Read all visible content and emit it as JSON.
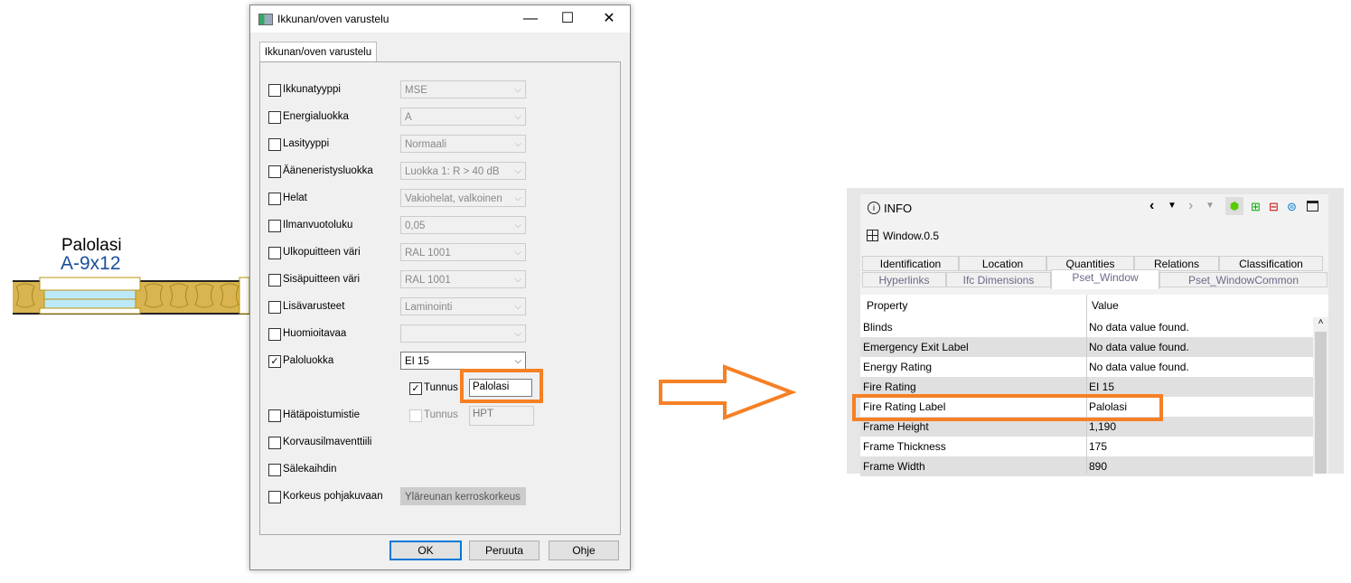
{
  "drawing": {
    "label1": "Palolasi",
    "label2": "A-9x12"
  },
  "dialog": {
    "title": "Ikkunan/oven varustelu",
    "tab": "Ikkunan/oven varustelu",
    "rows": [
      {
        "label": "Ikkunatyyppi",
        "value": "MSE",
        "checked": false
      },
      {
        "label": "Energialuokka",
        "value": "A",
        "checked": false
      },
      {
        "label": "Lasityyppi",
        "value": "Normaali",
        "checked": false
      },
      {
        "label": "Ääneneristysluokka",
        "value": "Luokka 1: R > 40 dB",
        "checked": false
      },
      {
        "label": "Helat",
        "value": "Vakiohelat, valkoinen",
        "checked": false
      },
      {
        "label": "Ilmanvuotoluku",
        "value": "0,05",
        "checked": false
      },
      {
        "label": "Ulkopuitteen väri",
        "value": "RAL 1001",
        "checked": false
      },
      {
        "label": "Sisäpuitteen väri",
        "value": "RAL 1001",
        "checked": false
      },
      {
        "label": "Lisävarusteet",
        "value": "Laminointi",
        "checked": false
      },
      {
        "label": "Huomioitavaa",
        "value": "",
        "checked": false
      },
      {
        "label": "Paloluokka",
        "value": "EI 15",
        "checked": true
      },
      {
        "label": "Hätäpoistumistie",
        "checked": false
      },
      {
        "label": "Korvausilmaventtiili",
        "checked": false
      },
      {
        "label": "Sälekaihdin",
        "checked": false
      },
      {
        "label": "Korkeus pohjakuvaan",
        "value": "Yläreunan kerroskorkeus",
        "checked": false
      }
    ],
    "fire_tunnus": {
      "label": "Tunnus",
      "value": "Palolasi",
      "checked": true
    },
    "exit_tunnus": {
      "label": "Tunnus",
      "value": "HPT",
      "checked": false
    },
    "ok": "OK",
    "cancel": "Peruuta",
    "help": "Ohje"
  },
  "info": {
    "title": "INFO",
    "object": "Window.0.5",
    "tabs_row1": [
      "Identification",
      "Location",
      "Quantities",
      "Relations",
      "Classification"
    ],
    "tabs_row2": [
      "Hyperlinks",
      "Ifc Dimensions",
      "Pset_Window",
      "Pset_WindowCommon"
    ],
    "active_tab": "Pset_Window",
    "col_property": "Property",
    "col_value": "Value",
    "rows": [
      {
        "property": "Blinds",
        "value": "No data value found."
      },
      {
        "property": "Emergency Exit Label",
        "value": "No data value found."
      },
      {
        "property": "Energy Rating",
        "value": "No data value found."
      },
      {
        "property": "Fire Rating",
        "value": "EI 15"
      },
      {
        "property": "Fire Rating Label",
        "value": "Palolasi"
      },
      {
        "property": "Frame Height",
        "value": "1,190"
      },
      {
        "property": "Frame Thickness",
        "value": "175"
      },
      {
        "property": "Frame Width",
        "value": "890"
      }
    ]
  },
  "colors": {
    "highlight": "#f58025",
    "drawing_blue": "#1a4f9c",
    "wall": "#d9b451",
    "glass": "#bde8f9"
  }
}
